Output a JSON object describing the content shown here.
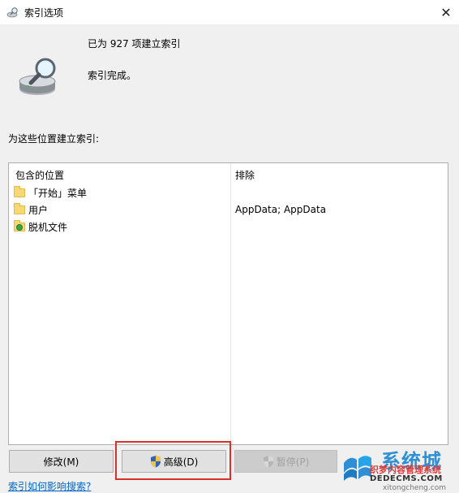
{
  "window": {
    "title": "索引选项",
    "close_glyph": "✕"
  },
  "status": {
    "indexed_count_text": "已为 927 项建立索引",
    "state_text": "索引完成。"
  },
  "locations": {
    "section_label": "为这些位置建立索引:",
    "included_header": "包含的位置",
    "exclude_header": "排除",
    "items": [
      {
        "label": "「开始」菜单",
        "icon": "folder-icon",
        "exclude": ""
      },
      {
        "label": "用户",
        "icon": "folder-icon",
        "exclude": "AppData; AppData"
      },
      {
        "label": "脱机文件",
        "icon": "offline-files-icon",
        "exclude": ""
      }
    ]
  },
  "buttons": {
    "modify": "修改(M)",
    "advanced": "高级(D)",
    "pause": "暂停(P)"
  },
  "help_link": "索引如何影响搜索?",
  "watermark": {
    "brand": "系统城",
    "line1": "织梦内容管理系统",
    "line2": "DEDECMS.COM",
    "line3": "xitongcheng.com"
  },
  "colors": {
    "highlight": "#d9302c",
    "link": "#0066cc"
  }
}
